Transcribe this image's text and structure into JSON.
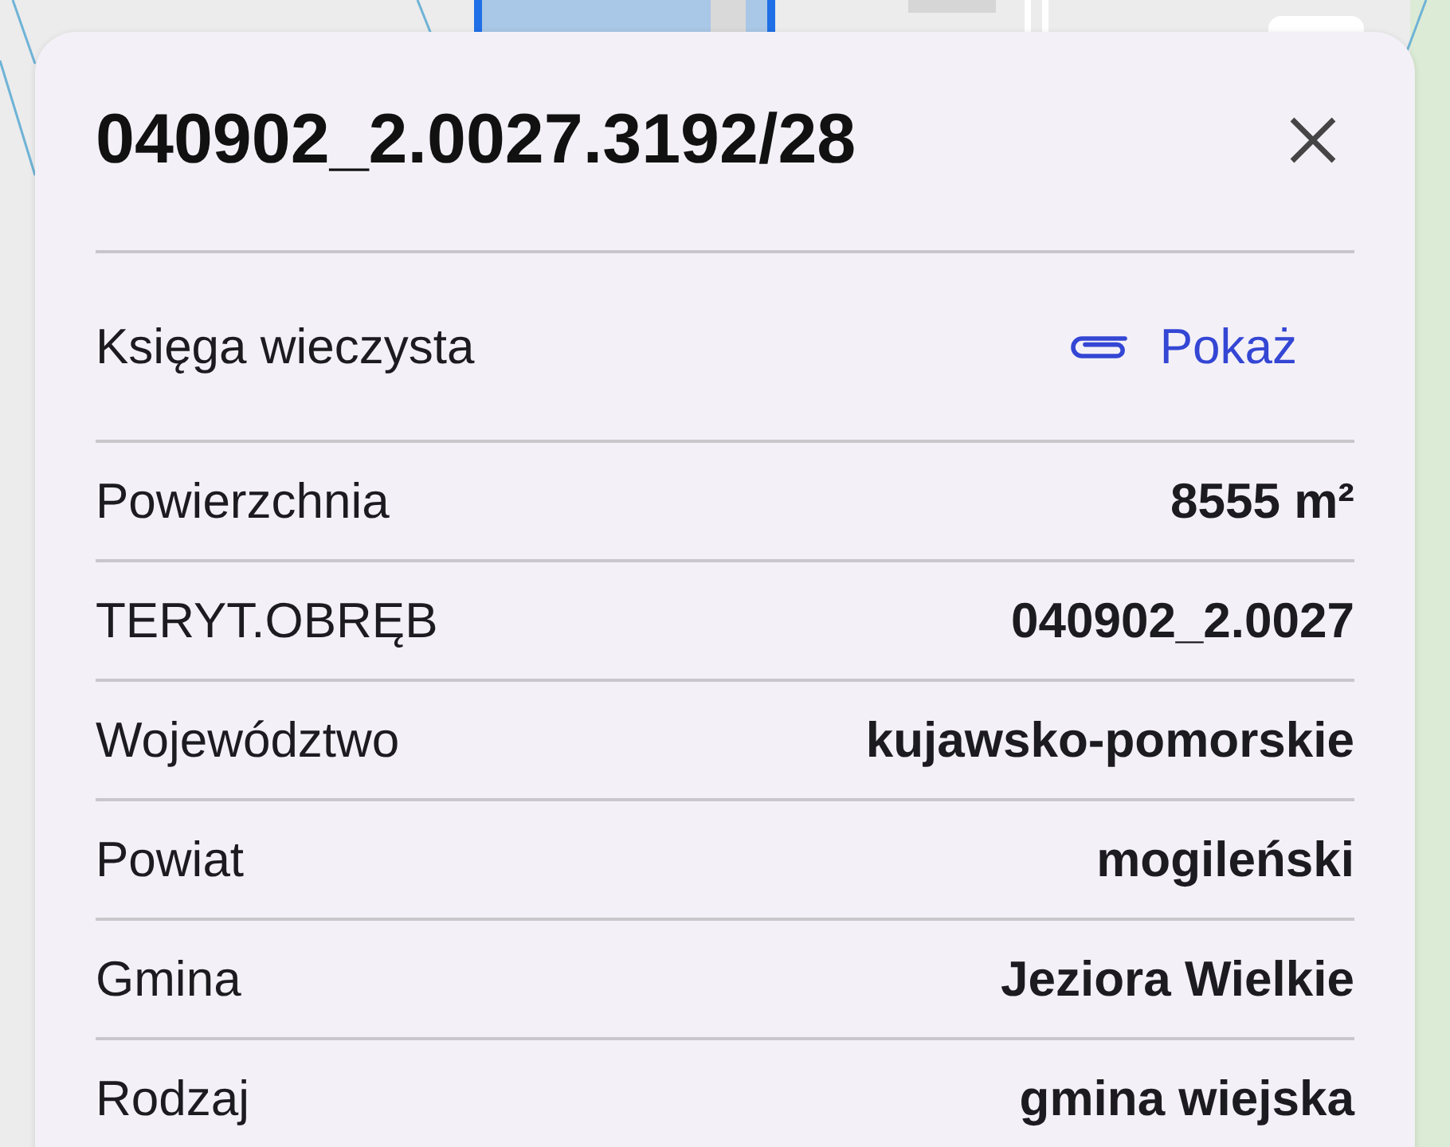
{
  "card": {
    "title": "040902_2.0027.3192/28"
  },
  "rows": [
    {
      "kind": "link",
      "label": "Księga wieczysta",
      "action": "Pokaż"
    },
    {
      "kind": "value",
      "label": "Powierzchnia",
      "value": "8555 m²"
    },
    {
      "kind": "value",
      "label": "TERYT.OBRĘB",
      "value": "040902_2.0027"
    },
    {
      "kind": "value",
      "label": "Województwo",
      "value": "kujawsko-pomorskie"
    },
    {
      "kind": "value",
      "label": "Powiat",
      "value": "mogileński"
    },
    {
      "kind": "value",
      "label": "Gmina",
      "value": "Jeziora Wielkie"
    },
    {
      "kind": "value",
      "label": "Rodzaj",
      "value": "gmina wiejska"
    }
  ]
}
